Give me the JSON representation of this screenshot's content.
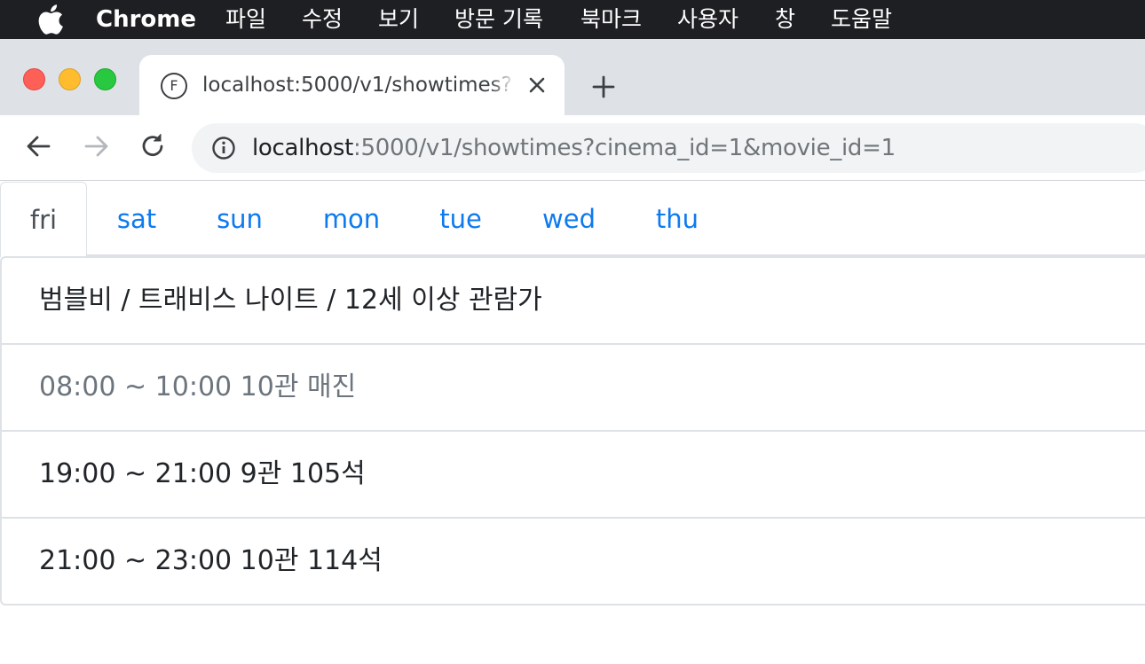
{
  "menubar": {
    "app_name": "Chrome",
    "items": [
      "파일",
      "수정",
      "보기",
      "방문 기록",
      "북마크",
      "사용자",
      "창",
      "도움말"
    ]
  },
  "browser": {
    "tab": {
      "favicon_letter": "F",
      "title": "localhost:5000/v1/showtimes?cinema_id=1&movie_id=1"
    },
    "address_bar": {
      "host": "localhost",
      "rest": ":5000/v1/showtimes?cinema_id=1&movie_id=1"
    }
  },
  "page": {
    "day_tabs": [
      {
        "label": "fri",
        "active": true
      },
      {
        "label": "sat",
        "active": false
      },
      {
        "label": "sun",
        "active": false
      },
      {
        "label": "mon",
        "active": false
      },
      {
        "label": "tue",
        "active": false
      },
      {
        "label": "wed",
        "active": false
      },
      {
        "label": "thu",
        "active": false
      }
    ],
    "movie_header": "범블비 / 트래비스 나이트 / 12세 이상 관람가",
    "showtimes": [
      {
        "text": "08:00 ~ 10:00 10관 매진",
        "sold_out": true
      },
      {
        "text": "19:00 ~ 21:00 9관 105석",
        "sold_out": false
      },
      {
        "text": "21:00 ~ 23:00 10관 114석",
        "sold_out": false
      }
    ]
  },
  "colors": {
    "link": "#0d7aef",
    "active_tab_text": "#495057",
    "muted": "#6c757d",
    "border": "#dee2e6"
  }
}
